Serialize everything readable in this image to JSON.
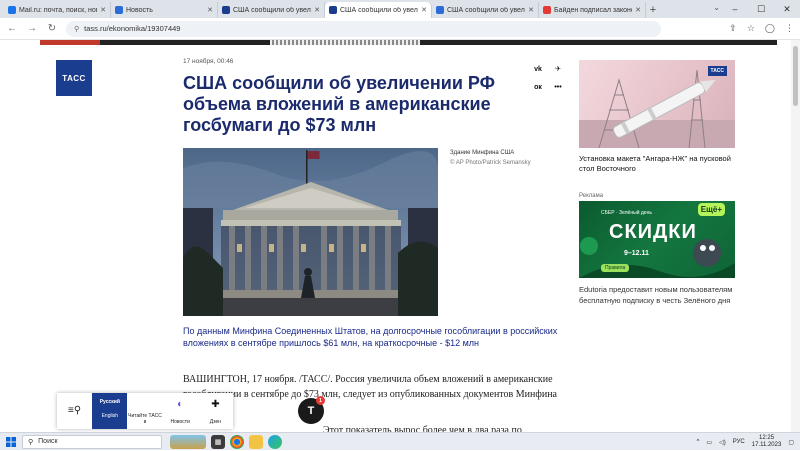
{
  "browser": {
    "tabs": [
      {
        "title": "Mail.ru: почта, поиск, новости",
        "color": "#1a73e8",
        "active": false
      },
      {
        "title": "Новость",
        "color": "#2c6bd8",
        "active": false
      },
      {
        "title": "США сообщили об увеличении",
        "color": "#1a3d8f",
        "active": false
      },
      {
        "title": "США сообщили об увеличении",
        "color": "#1a3d8f",
        "active": true
      },
      {
        "title": "США сообщили об увеличении",
        "color": "#2c6bd8",
        "active": false
      },
      {
        "title": "Байден подписал законопроект",
        "color": "#e53935",
        "active": false
      }
    ],
    "new_tab": "+",
    "url": "tass.ru/ekonomika/19307449"
  },
  "site": {
    "logo": "ТАСС"
  },
  "article": {
    "date": "17 ноября, 00:46",
    "headline": "США сообщили об увеличении РФ объема вложений в американские госбумаги до $73 млн",
    "photo_caption": "Здание Минфина США",
    "photo_credit": "© AP Photo/Patrick Semansky",
    "lead": "По данным Минфина Соединенных Штатов, на долгосрочные гособлигации в российских вложениях в сентябре пришлось $61 млн, на краткосрочные - $12 млн",
    "body_1": "ВАШИНГТОН, 17 ноября. /ТАСС/. Россия увеличила объем вложений в американские гособлигации в сентябре до $73 млн, следует из опубликованных документов Минфина США.",
    "body_2": "Этот показатель вырос более чем в два раза по"
  },
  "share": {
    "vk": "vk",
    "telegram": "✈",
    "ok": "ок",
    "more": "•••"
  },
  "sidebar": {
    "card_tag": "ТАСС",
    "card_caption": "Установка макета \"Ангара-НЖ\" на пусковой стол Восточного",
    "ad_label": "Реклама",
    "ad_top": "СБЕР · Зелёный день",
    "ad_big": "СКИДКИ",
    "ad_dates": "9–12.11",
    "ad_button": "Правила",
    "ad_pct": "Ещё+",
    "ad_text": "Edutoria предоставит новым пользователям бесплатную подписку в честь Зелёного дня"
  },
  "widget": {
    "lang": "Русский",
    "lang_sub": "English",
    "read": "Читайте ТАСС в",
    "news": "Новости",
    "dzen": "Дзен"
  },
  "float_button": {
    "letter": "Т",
    "badge": "1"
  },
  "taskbar": {
    "search_placeholder": "Поиск",
    "lang": "РУС",
    "time": "12:25",
    "date": "17.11.2023"
  }
}
